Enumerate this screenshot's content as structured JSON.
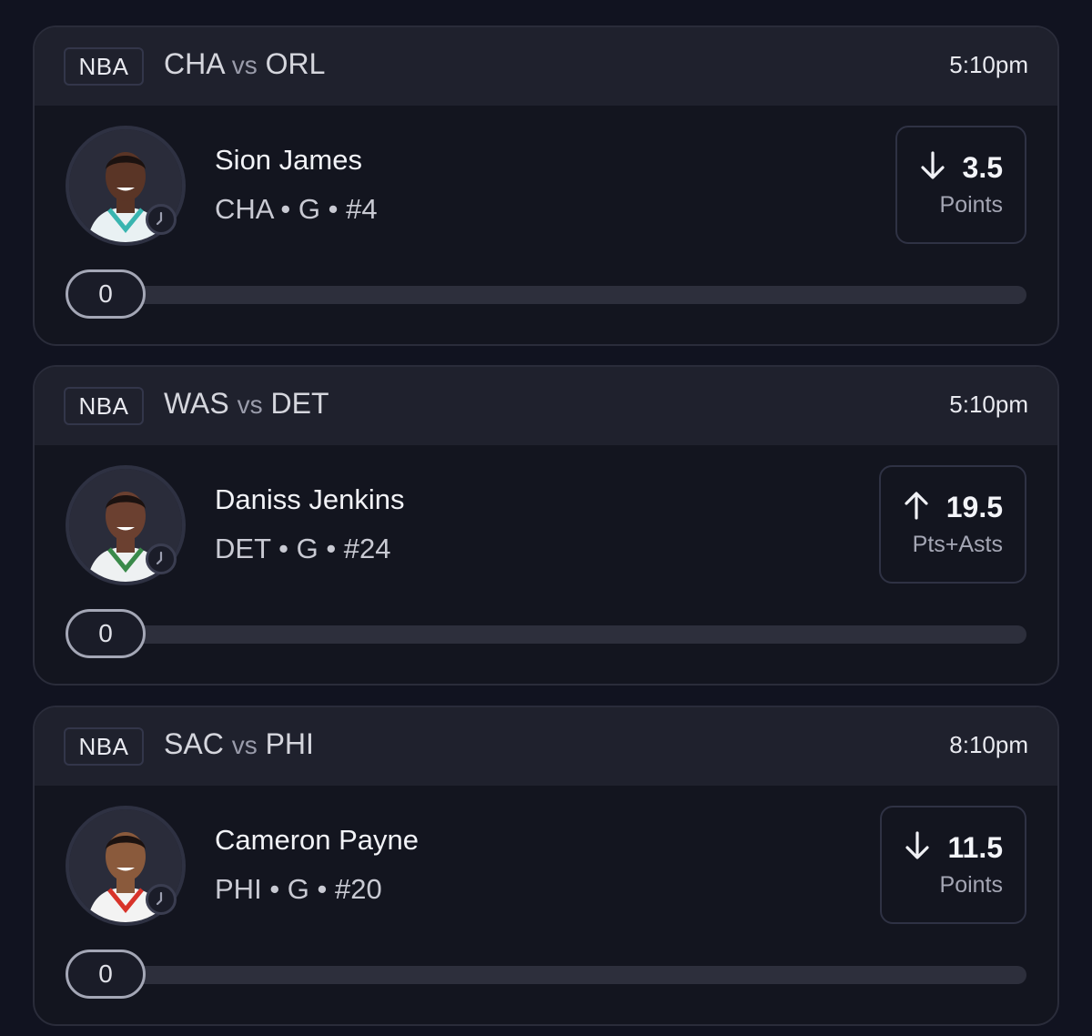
{
  "picks": [
    {
      "league": "NBA",
      "team_a": "CHA",
      "vs": "vs",
      "team_b": "ORL",
      "time": "5:10pm",
      "player": {
        "name": "Sion James",
        "team": "CHA",
        "position": "G",
        "number": "#4"
      },
      "line": {
        "direction": "down",
        "value": "3.5",
        "stat": "Points"
      },
      "progress": {
        "value": "0",
        "fraction": 0
      },
      "colors": {
        "skin": "#5a3526",
        "jersey": "#e9f1f3",
        "trim": "#39b5b0"
      }
    },
    {
      "league": "NBA",
      "team_a": "WAS",
      "vs": "vs",
      "team_b": "DET",
      "time": "5:10pm",
      "player": {
        "name": "Daniss Jenkins",
        "team": "DET",
        "position": "G",
        "number": "#24"
      },
      "line": {
        "direction": "up",
        "value": "19.5",
        "stat": "Pts+Asts"
      },
      "progress": {
        "value": "0",
        "fraction": 0
      },
      "colors": {
        "skin": "#6b4030",
        "jersey": "#eef1f2",
        "trim": "#3a8a4a"
      }
    },
    {
      "league": "NBA",
      "team_a": "SAC",
      "vs": "vs",
      "team_b": "PHI",
      "time": "8:10pm",
      "player": {
        "name": "Cameron Payne",
        "team": "PHI",
        "position": "G",
        "number": "#20"
      },
      "line": {
        "direction": "down",
        "value": "11.5",
        "stat": "Points"
      },
      "progress": {
        "value": "0",
        "fraction": 0
      },
      "colors": {
        "skin": "#8a5a3c",
        "jersey": "#f3f3f3",
        "trim": "#d8332a"
      }
    }
  ],
  "separator": "•",
  "icons": {
    "down": "arrow-down-icon",
    "up": "arrow-up-icon",
    "clock": "clock-icon"
  }
}
